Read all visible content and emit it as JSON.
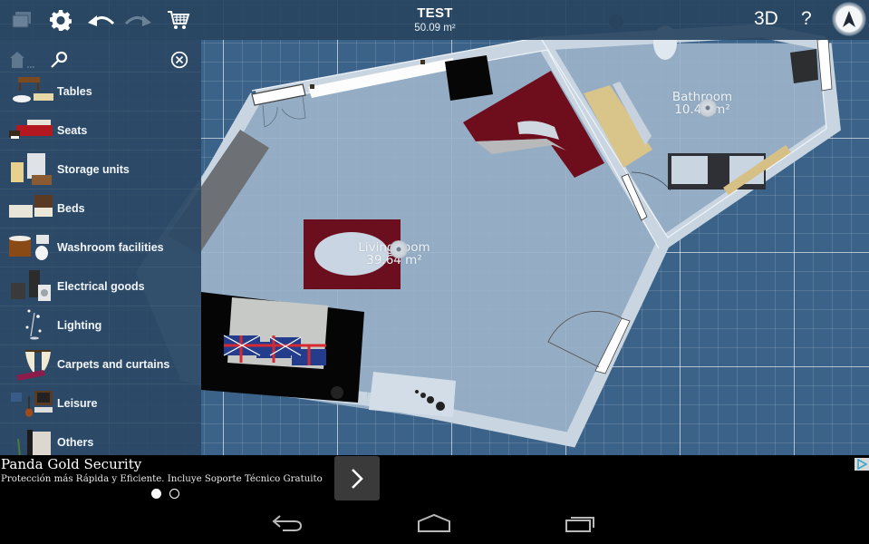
{
  "app": {
    "project_title": "TEST",
    "total_area": "50.09 m²"
  },
  "toolbar": {
    "left_icons": [
      {
        "name": "layers-icon",
        "enabled": false
      },
      {
        "name": "settings-gear-icon",
        "enabled": true
      },
      {
        "name": "undo-icon",
        "enabled": true
      },
      {
        "name": "redo-icon",
        "enabled": false
      },
      {
        "name": "shopping-cart-icon",
        "enabled": true
      }
    ],
    "view_3d_label": "3D",
    "help_label": "?",
    "compass_icon": "compass-north-arrow-icon"
  },
  "sidebar": {
    "tools": [
      {
        "name": "home-catalog-icon",
        "enabled": false
      },
      {
        "name": "search-icon",
        "enabled": true
      },
      {
        "name": "close-circle-icon",
        "enabled": true
      }
    ],
    "categories": [
      {
        "label": "Tables",
        "thumb": "tables"
      },
      {
        "label": "Seats",
        "thumb": "seats"
      },
      {
        "label": "Storage units",
        "thumb": "storage"
      },
      {
        "label": "Beds",
        "thumb": "beds"
      },
      {
        "label": "Washroom facilities",
        "thumb": "washroom"
      },
      {
        "label": "Electrical goods",
        "thumb": "electrical"
      },
      {
        "label": "Lighting",
        "thumb": "lighting"
      },
      {
        "label": "Carpets and curtains",
        "thumb": "carpets"
      },
      {
        "label": "Leisure",
        "thumb": "leisure"
      },
      {
        "label": "Others",
        "thumb": "others"
      }
    ]
  },
  "plan": {
    "rooms": [
      {
        "name": "Living room",
        "area": "39.64 m²"
      },
      {
        "name": "Bathroom",
        "area": "10.45 m²"
      }
    ],
    "colors": {
      "grid_background": "#3b6288",
      "floor": "#9cb3ca",
      "wall": "#c9d6e2",
      "rug": "#6b0f1e",
      "sofa_corner": "#6e0d1c",
      "wood": "#d9c48a"
    }
  },
  "ad": {
    "title": "Panda Gold Security",
    "subtitle": "Protección más Rápida y Eficiente. Incluye Soporte Técnico Gratuito",
    "page_count": 2,
    "active_page": 1,
    "next_icon": "chevron-right-icon",
    "adchoices_icon": "adchoices-icon"
  },
  "navbar": {
    "buttons": [
      "back-icon",
      "home-icon",
      "recent-apps-icon"
    ]
  }
}
